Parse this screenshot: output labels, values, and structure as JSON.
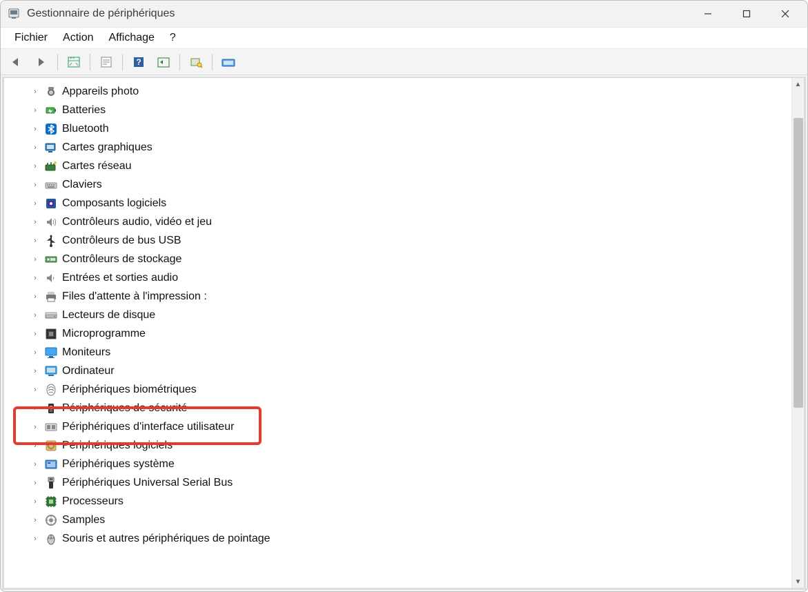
{
  "window": {
    "title": "Gestionnaire de périphériques"
  },
  "menu": {
    "items": [
      {
        "label": "Fichier"
      },
      {
        "label": "Action"
      },
      {
        "label": "Affichage"
      },
      {
        "label": "?"
      }
    ]
  },
  "toolbar_icons": [
    "nav-back",
    "nav-forward",
    "sep",
    "show-hidden",
    "sep",
    "properties",
    "sep",
    "help",
    "refresh",
    "sep",
    "scan-hardware",
    "sep",
    "add-legacy"
  ],
  "tree": {
    "items": [
      {
        "label": "Appareils photo",
        "icon": "camera"
      },
      {
        "label": "Batteries",
        "icon": "battery"
      },
      {
        "label": "Bluetooth",
        "icon": "bluetooth"
      },
      {
        "label": "Cartes graphiques",
        "icon": "display-adapter"
      },
      {
        "label": "Cartes réseau",
        "icon": "network-adapter"
      },
      {
        "label": "Claviers",
        "icon": "keyboard"
      },
      {
        "label": "Composants logiciels",
        "icon": "software-component"
      },
      {
        "label": "Contrôleurs audio, vidéo et jeu",
        "icon": "speaker"
      },
      {
        "label": "Contrôleurs de bus USB",
        "icon": "usb"
      },
      {
        "label": "Contrôleurs de stockage",
        "icon": "storage-controller"
      },
      {
        "label": "Entrées et sorties audio",
        "icon": "audio-io"
      },
      {
        "label": "Files d'attente à l'impression :",
        "icon": "printer"
      },
      {
        "label": "Lecteurs de disque",
        "icon": "disk-drive"
      },
      {
        "label": "Microprogramme",
        "icon": "firmware"
      },
      {
        "label": "Moniteurs",
        "icon": "monitor"
      },
      {
        "label": "Ordinateur",
        "icon": "computer"
      },
      {
        "label": "Périphériques biométriques",
        "icon": "biometric"
      },
      {
        "label": "Périphériques de sécurité",
        "icon": "security"
      },
      {
        "label": "Périphériques d'interface utilisateur",
        "icon": "hid",
        "highlighted": true
      },
      {
        "label": "Périphériques logiciels",
        "icon": "software-device"
      },
      {
        "label": "Périphériques système",
        "icon": "system-device"
      },
      {
        "label": "Périphériques Universal Serial Bus",
        "icon": "usb-connector"
      },
      {
        "label": "Processeurs",
        "icon": "processor"
      },
      {
        "label": "Samples",
        "icon": "samples"
      },
      {
        "label": "Souris et autres périphériques de pointage",
        "icon": "mouse"
      }
    ]
  }
}
